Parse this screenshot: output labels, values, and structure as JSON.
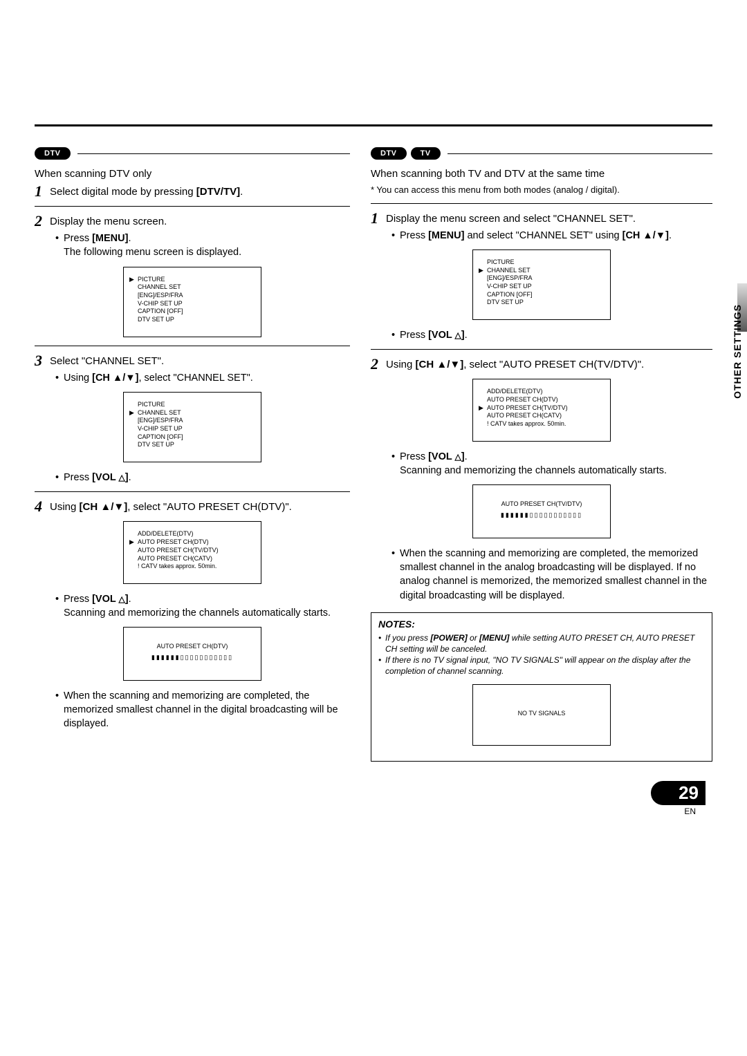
{
  "pills": {
    "dtv": "DTV",
    "tv": "TV"
  },
  "sidetab": "OTHER SETTINGS",
  "page_number": "29",
  "page_lang": "EN",
  "osd_menu": {
    "picture": "PICTURE",
    "channel_set": "CHANNEL SET",
    "lang": "[ENG]/ESP/FRA",
    "vchip": "V-CHIP SET UP",
    "caption": "CAPTION [OFF]",
    "dtv": "DTV SET UP"
  },
  "osd_preset": {
    "add_delete": "ADD/DELETE(DTV)",
    "preset_dtv": "AUTO PRESET CH(DTV)",
    "preset_tvdtv": "AUTO PRESET CH(TV/DTV)",
    "preset_catv": "AUTO PRESET CH(CATV)",
    "warn": "! CATV takes approx. 50min."
  },
  "osd_prog_dtv": "AUTO PRESET CH(DTV)",
  "osd_prog_tvdtv": "AUTO PRESET CH(TV/DTV)",
  "progress_bar": "▮▮▮▮▮▮▯▯▯▯▯▯▯▯▯▯▯",
  "osd_nosig": "NO TV SIGNALS",
  "left": {
    "intro": "When scanning DTV only",
    "s1": "Select digital mode by pressing ",
    "s1_b": "[DTV/TV]",
    "s2": "Display the menu screen.",
    "s2_b1a": "Press ",
    "s2_b1b": "[MENU]",
    "s2_b2": "The following menu screen is displayed.",
    "s3": "Select \"CHANNEL SET\".",
    "s3_b1a": "Using ",
    "s3_b1b": "[CH ▲/▼]",
    "s3_b1c": ", select \"CHANNEL SET\".",
    "s3_b2a": "Press ",
    "s3_b2b": "[VOL ",
    "s3_b2c": "]",
    "s4a": "Using ",
    "s4b": "[CH ▲/▼]",
    "s4c": ", select \"AUTO PRESET CH(DTV)\".",
    "s4_b1a": "Press ",
    "s4_b1b": "[VOL ",
    "s4_b1c": "]",
    "s4_b2": "Scanning and memorizing the channels automatically starts.",
    "s4_end": "When the scanning and memorizing are completed, the memorized smallest channel in the digital broadcasting will be displayed."
  },
  "right": {
    "intro": "When scanning both TV and  DTV at the same time",
    "sub": "* You can access this menu from both modes (analog / digital).",
    "s1": "Display the menu screen and select \"CHANNEL SET\".",
    "s1_b1a": "Press ",
    "s1_b1b": "[MENU]",
    "s1_b1c": " and select \"CHANNEL SET\" using ",
    "s1_b1d": "[CH ▲/▼]",
    "s1_b2a": "Press ",
    "s1_b2b": "[VOL ",
    "s1_b2c": "]",
    "s2a": "Using ",
    "s2b": "[CH ▲/▼]",
    "s2c": ", select \"AUTO PRESET CH(TV/DTV)\".",
    "s2_b1a": "Press ",
    "s2_b1b": "[VOL ",
    "s2_b1c": "]",
    "s2_b2": "Scanning and memorizing the channels automatically starts.",
    "s2_end": "When the scanning and memorizing are completed, the memorized smallest channel in the analog broadcasting will be displayed. If no analog channel is memorized, the memorized smallest channel in the digital broadcasting will be displayed."
  },
  "notes": {
    "title": "NOTES:",
    "n1a": "If you press ",
    "n1b": "[POWER]",
    "n1c": " or ",
    "n1d": "[MENU]",
    "n1e": " while setting AUTO PRESET CH, AUTO PRESET CH setting will be canceled.",
    "n2": "If there is no TV signal input, \"NO TV SIGNALS\" will appear on the display after the completion of channel scanning."
  }
}
